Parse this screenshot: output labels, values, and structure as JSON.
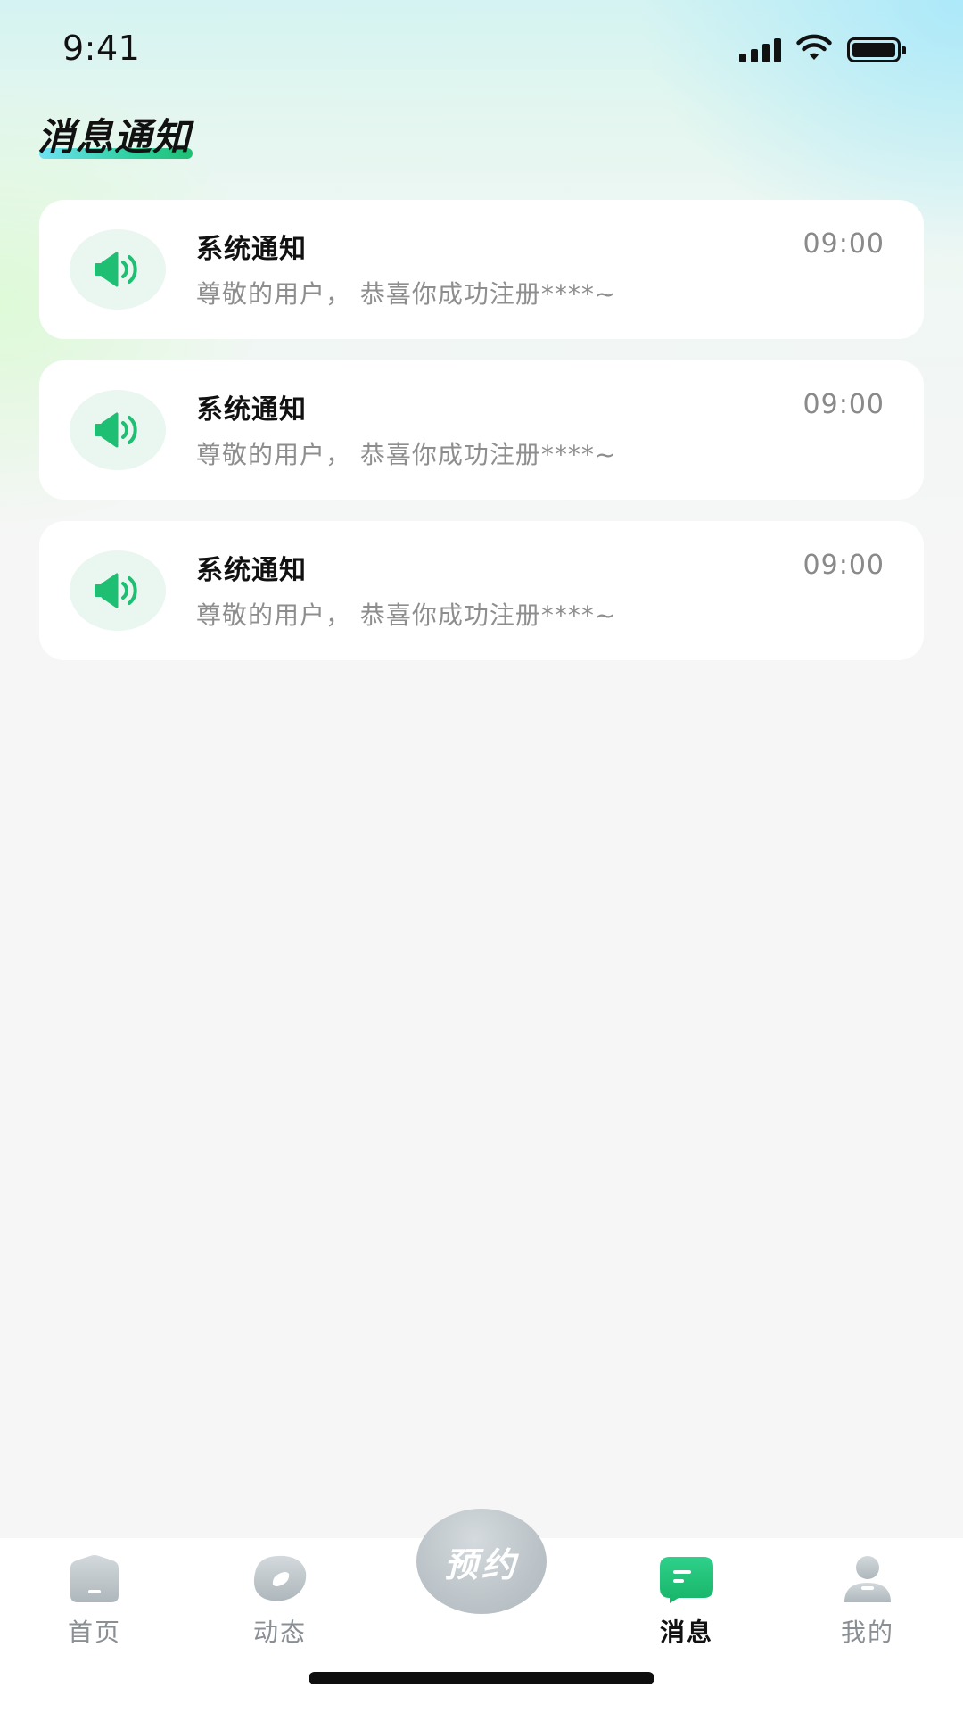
{
  "status_bar": {
    "time": "9:41"
  },
  "header": {
    "title": "消息通知"
  },
  "notifications": [
    {
      "title": "系统通知",
      "time": "09:00",
      "body": "尊敬的用户， 恭喜你成功注册****~",
      "icon": "speaker-icon"
    },
    {
      "title": "系统通知",
      "time": "09:00",
      "body": "尊敬的用户， 恭喜你成功注册****~",
      "icon": "speaker-icon"
    },
    {
      "title": "系统通知",
      "time": "09:00",
      "body": "尊敬的用户， 恭喜你成功注册****~",
      "icon": "speaker-icon"
    }
  ],
  "tab_bar": {
    "items": [
      {
        "label": "首页",
        "icon": "home-icon",
        "active": false
      },
      {
        "label": "动态",
        "icon": "feed-icon",
        "active": false
      },
      {
        "label": "预约",
        "icon": "book-button",
        "active": false
      },
      {
        "label": "消息",
        "icon": "message-icon",
        "active": true
      },
      {
        "label": "我的",
        "icon": "profile-icon",
        "active": false
      }
    ]
  },
  "colors": {
    "accent": "#1fbf73",
    "icon_bg": "#e9f7f0",
    "inactive": "#bcc4c9",
    "text_secondary": "#8e8e8e"
  }
}
